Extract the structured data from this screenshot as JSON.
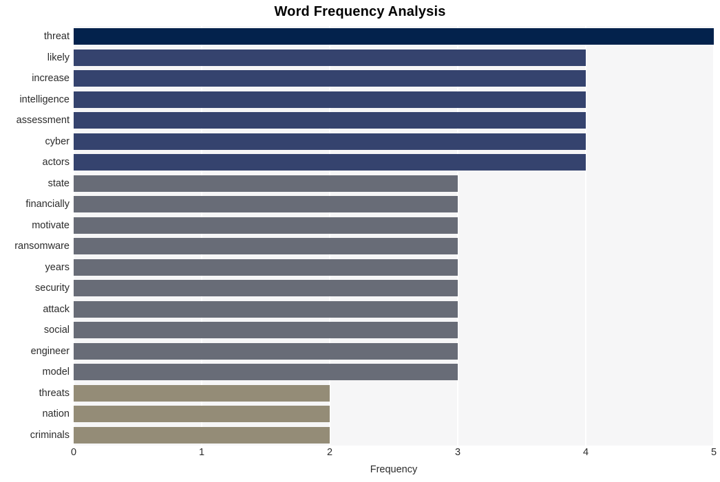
{
  "chart_data": {
    "type": "bar",
    "orientation": "horizontal",
    "title": "Word Frequency Analysis",
    "xlabel": "Frequency",
    "ylabel": "",
    "xlim": [
      0,
      5
    ],
    "xticks": [
      0,
      1,
      2,
      3,
      4,
      5
    ],
    "xtick_labels": [
      "0",
      "1",
      "2",
      "3",
      "4",
      "5"
    ],
    "grid": true,
    "grid_axis": "x",
    "legend": false,
    "background": "#f6f6f7",
    "categories": [
      "threat",
      "likely",
      "increase",
      "intelligence",
      "assessment",
      "cyber",
      "actors",
      "state",
      "financially",
      "motivate",
      "ransomware",
      "years",
      "security",
      "attack",
      "social",
      "engineer",
      "model",
      "threats",
      "nation",
      "criminals"
    ],
    "values": [
      5,
      4,
      4,
      4,
      4,
      4,
      4,
      3,
      3,
      3,
      3,
      3,
      3,
      3,
      3,
      3,
      3,
      2,
      2,
      2
    ],
    "bar_colors": [
      "#03224c",
      "#35436e",
      "#35436e",
      "#35436e",
      "#35436e",
      "#35436e",
      "#35436e",
      "#686c77",
      "#686c77",
      "#686c77",
      "#686c77",
      "#686c77",
      "#686c77",
      "#686c77",
      "#686c77",
      "#686c77",
      "#686c77",
      "#948c77",
      "#948c77",
      "#948c77"
    ],
    "palette": {
      "max": "#03224c",
      "high": "#35436e",
      "mid": "#686c77",
      "low": "#948c77"
    }
  }
}
